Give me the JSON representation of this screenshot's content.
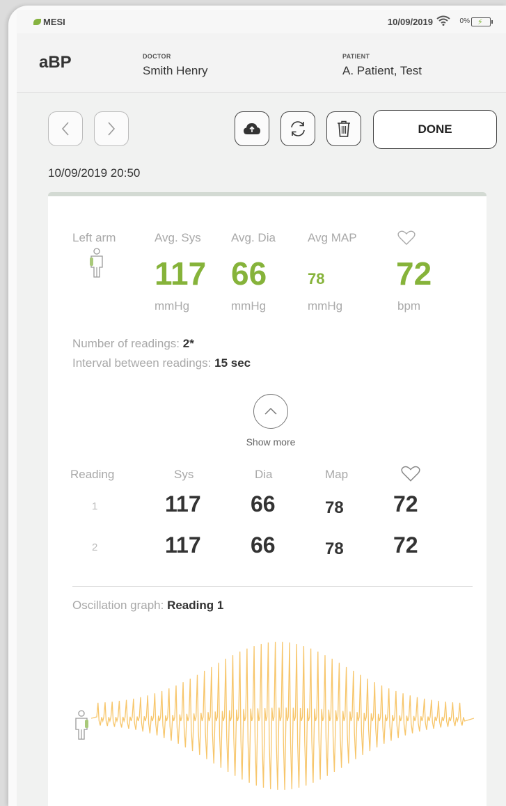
{
  "status_bar": {
    "brand": "MESI",
    "date": "10/09/2019",
    "battery": "0%"
  },
  "header": {
    "title": "aBP",
    "doctor_label": "DOCTOR",
    "doctor_name": "Smith Henry",
    "patient_label": "PATIENT",
    "patient_name": "A. Patient, Test"
  },
  "toolbar": {
    "done_label": "DONE",
    "icons": [
      "chevron-left-icon",
      "chevron-right-icon",
      "cloud-upload-icon",
      "sync-icon",
      "trash-icon"
    ]
  },
  "measurement": {
    "timestamp": "10/09/2019 20:50",
    "arm": "Left arm",
    "avg_sys_label": "Avg. Sys",
    "avg_dia_label": "Avg. Dia",
    "avg_map_label": "Avg MAP",
    "avg_sys": "117",
    "avg_dia": "66",
    "avg_map": "78",
    "pulse": "72",
    "unit_mmhg": "mmHg",
    "unit_bpm": "bpm",
    "readings_label": "Number of readings: ",
    "readings_value": "2*",
    "interval_label": "Interval between readings: ",
    "interval_value": "15 sec",
    "show_more": "Show more"
  },
  "readings_table": {
    "headers": {
      "reading": "Reading",
      "sys": "Sys",
      "dia": "Dia",
      "map": "Map"
    },
    "rows": [
      {
        "n": "1",
        "sys": "117",
        "dia": "66",
        "map": "78",
        "pulse": "72"
      },
      {
        "n": "2",
        "sys": "117",
        "dia": "66",
        "map": "78",
        "pulse": "72"
      }
    ]
  },
  "oscillation": {
    "label": "Oscillation graph: ",
    "reading": "Reading 1",
    "color": "#f7c66b"
  },
  "colors": {
    "accent_green": "#86b33a"
  }
}
